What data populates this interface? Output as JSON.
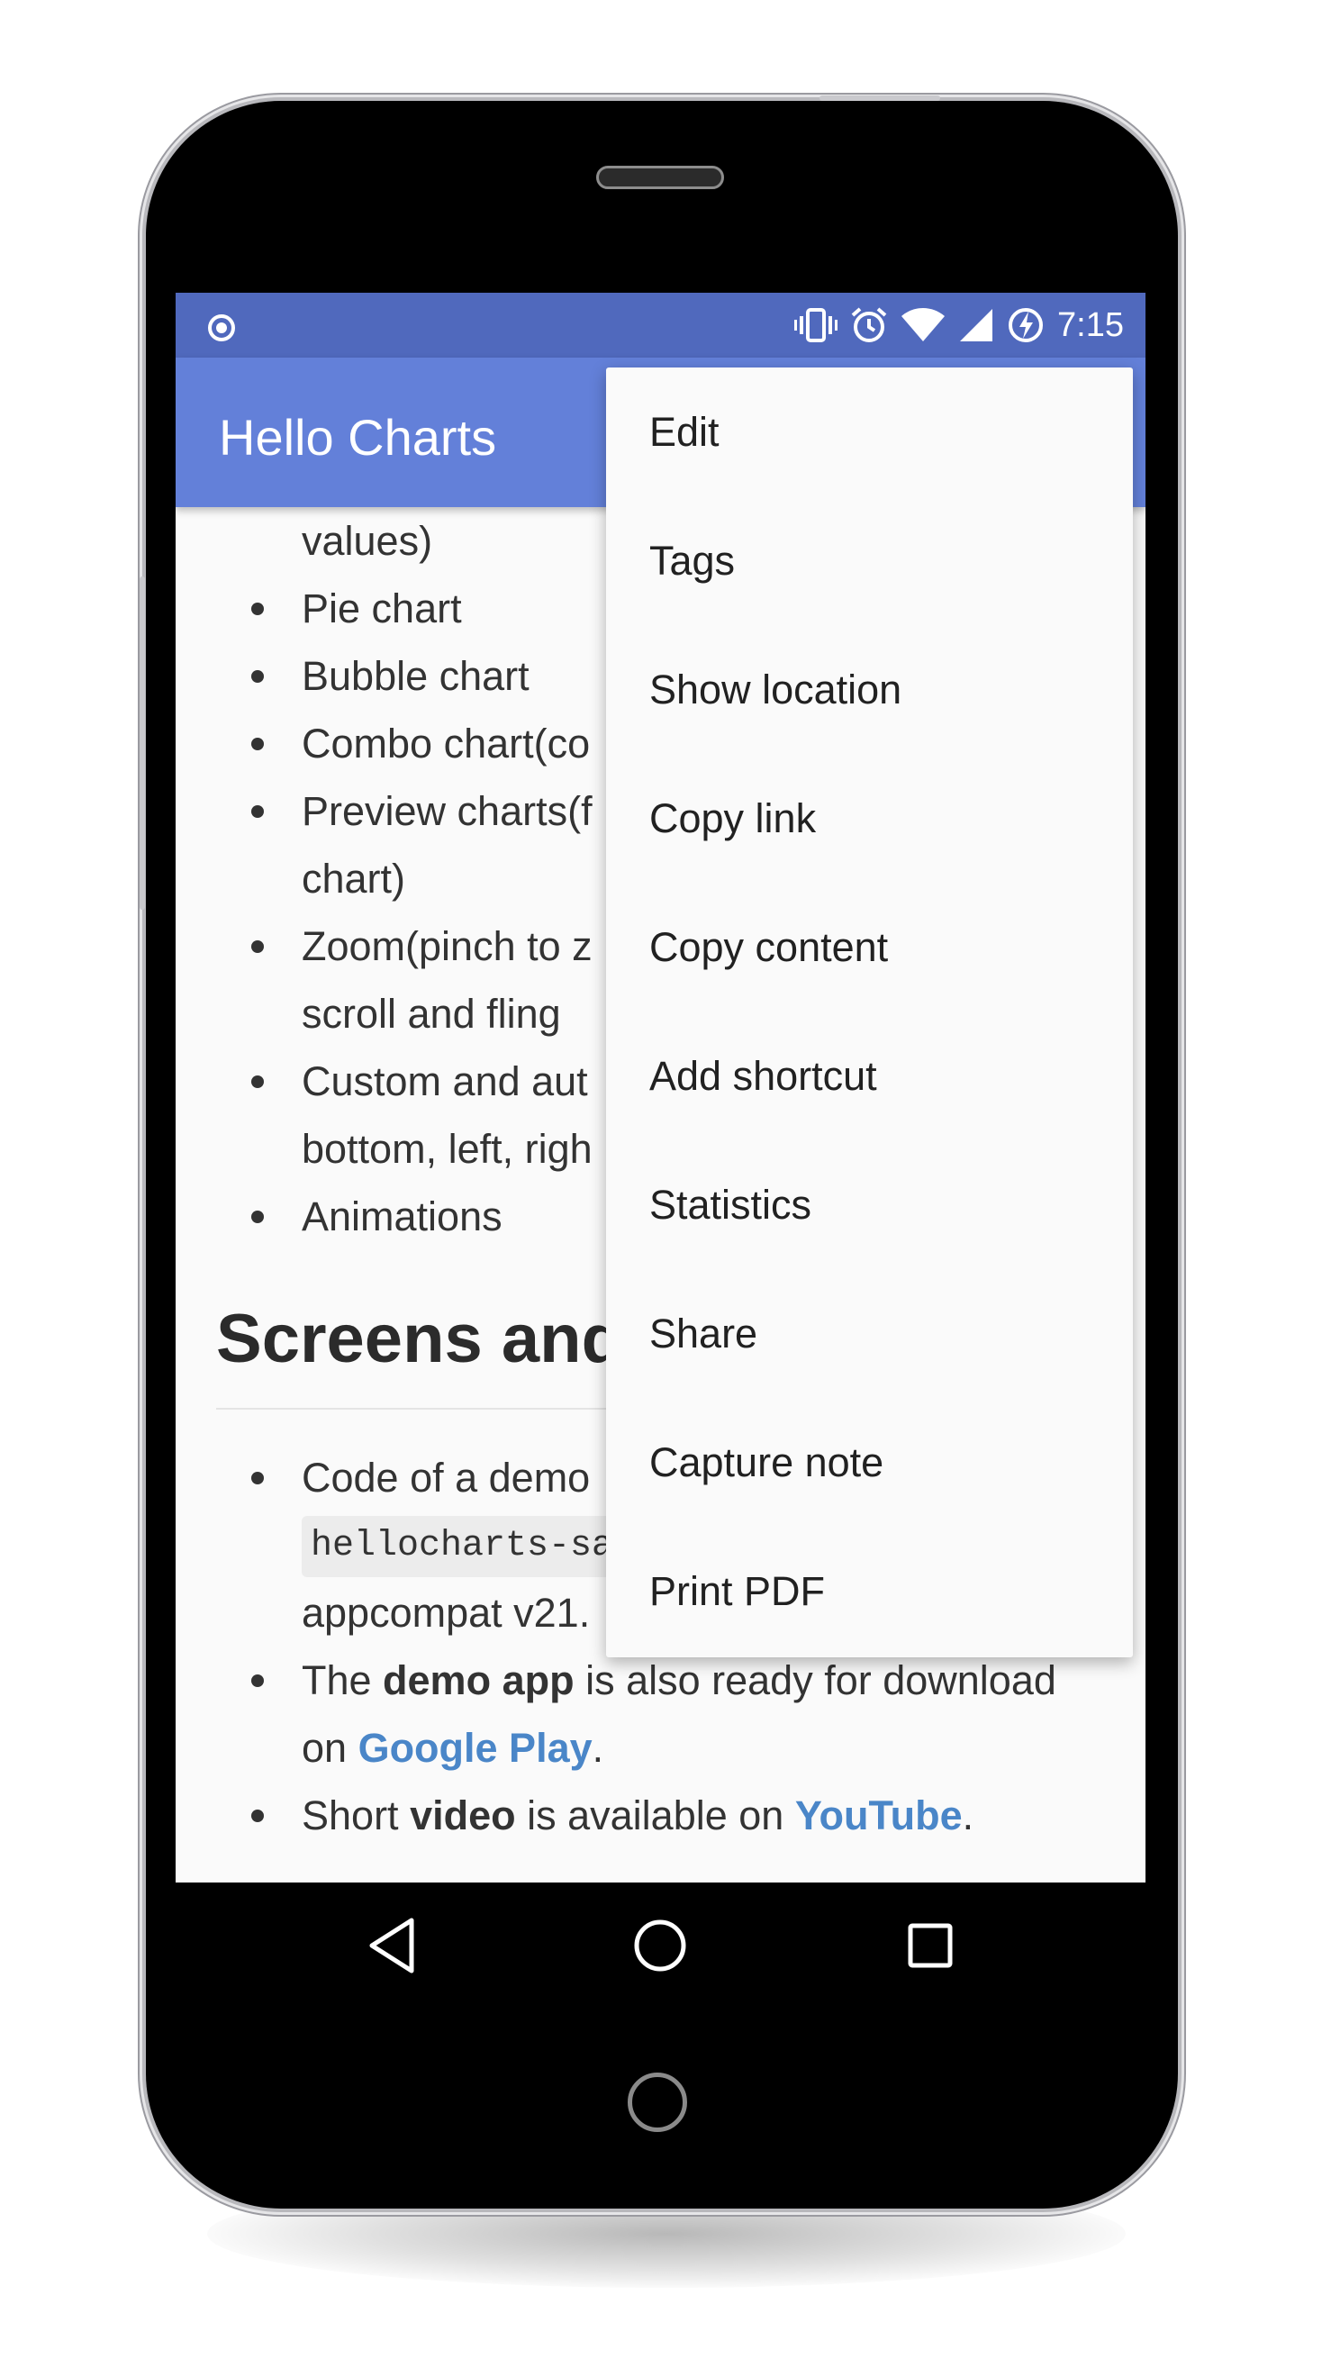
{
  "status_bar": {
    "time": "7:15",
    "icons": [
      "notification-dot-icon",
      "vibrate-icon",
      "alarm-icon",
      "wifi-icon",
      "cell-signal-icon",
      "battery-charging-icon"
    ]
  },
  "app_bar": {
    "title": "Hello Charts"
  },
  "content": {
    "features": [
      "values)",
      "Pie chart",
      "Bubble chart",
      "Combo chart(co",
      "Preview charts(f",
      "chart)",
      "Zoom(pinch to z",
      "scroll and fling",
      "Custom and aut",
      "bottom, left, righ",
      "Animations"
    ],
    "section_heading": "Screens and",
    "screens": {
      "item1_line1": "Code of a demo",
      "item1_code": "hellocharts-sampl",
      "item1_line3": "appcompat v21.",
      "item2_pre": "The ",
      "item2_bold": "demo app",
      "item2_mid": " is also ready for download",
      "item2_line2_pre": "on ",
      "item2_link": "Google Play",
      "item2_end": ".",
      "item3_pre": "Short ",
      "item3_bold": "video",
      "item3_mid": " is available on ",
      "item3_link": "YouTube",
      "item3_end": "."
    }
  },
  "menu": {
    "items": [
      "Edit",
      "Tags",
      "Show location",
      "Copy link",
      "Copy content",
      "Add shortcut",
      "Statistics",
      "Share",
      "Capture note",
      "Print PDF"
    ]
  },
  "nav_bar": {
    "icons": [
      "back-icon",
      "home-icon",
      "recents-icon"
    ]
  },
  "colors": {
    "status_bar": "#5069bd",
    "app_bar": "#6380d9",
    "link": "#4a86c8",
    "menu_bg": "#fafafa"
  }
}
